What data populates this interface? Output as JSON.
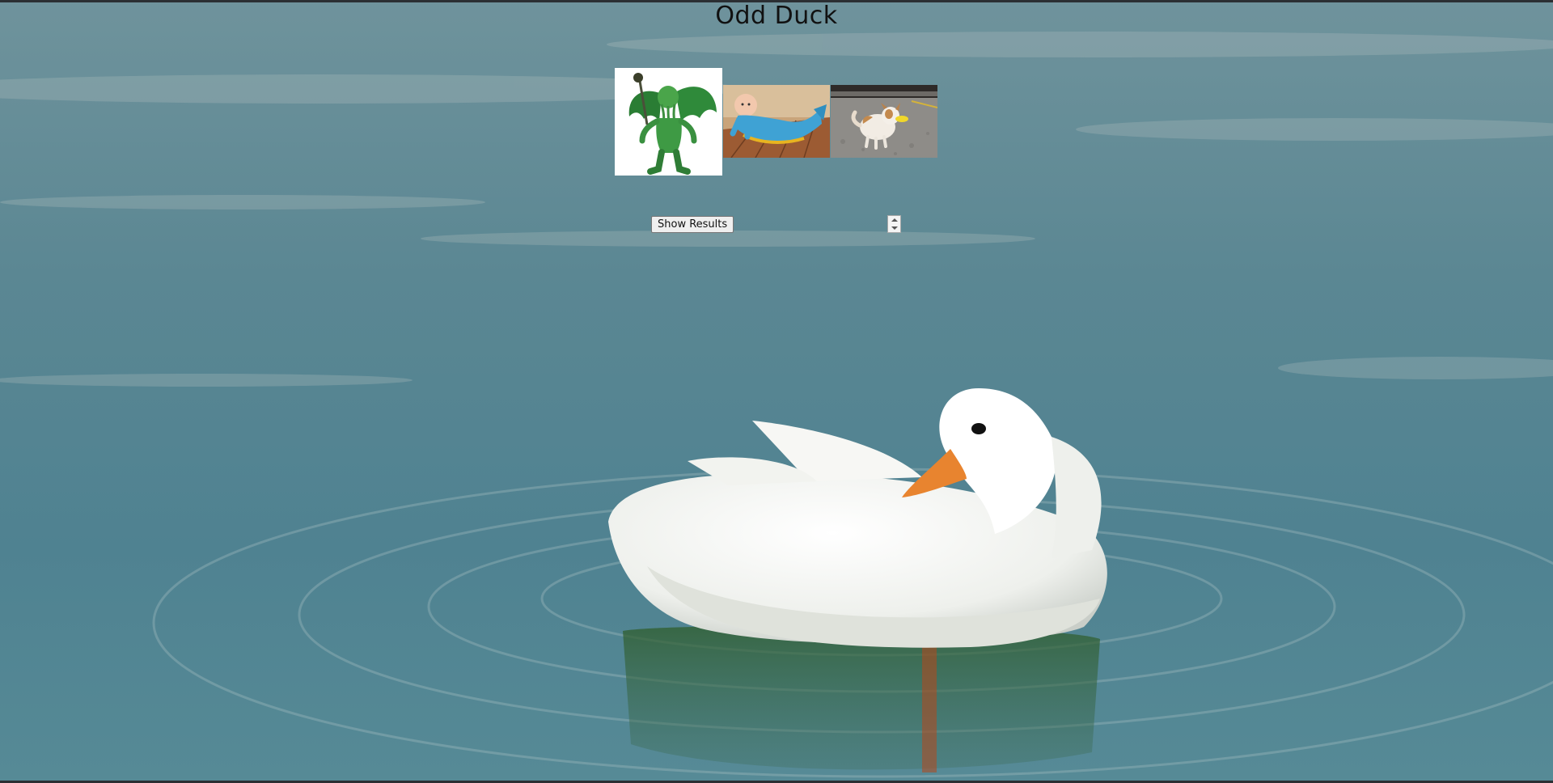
{
  "page": {
    "title": "Odd Duck"
  },
  "products": [
    {
      "icon": "cthulhu-figure-image"
    },
    {
      "icon": "baby-mermaid-sleeping-bag-image"
    },
    {
      "icon": "dog-duck-bill-image"
    }
  ],
  "controls": {
    "results_label": "Show Results"
  },
  "background": {
    "icon": "white-duck-on-water-image",
    "water_color": "#5f8c98"
  }
}
